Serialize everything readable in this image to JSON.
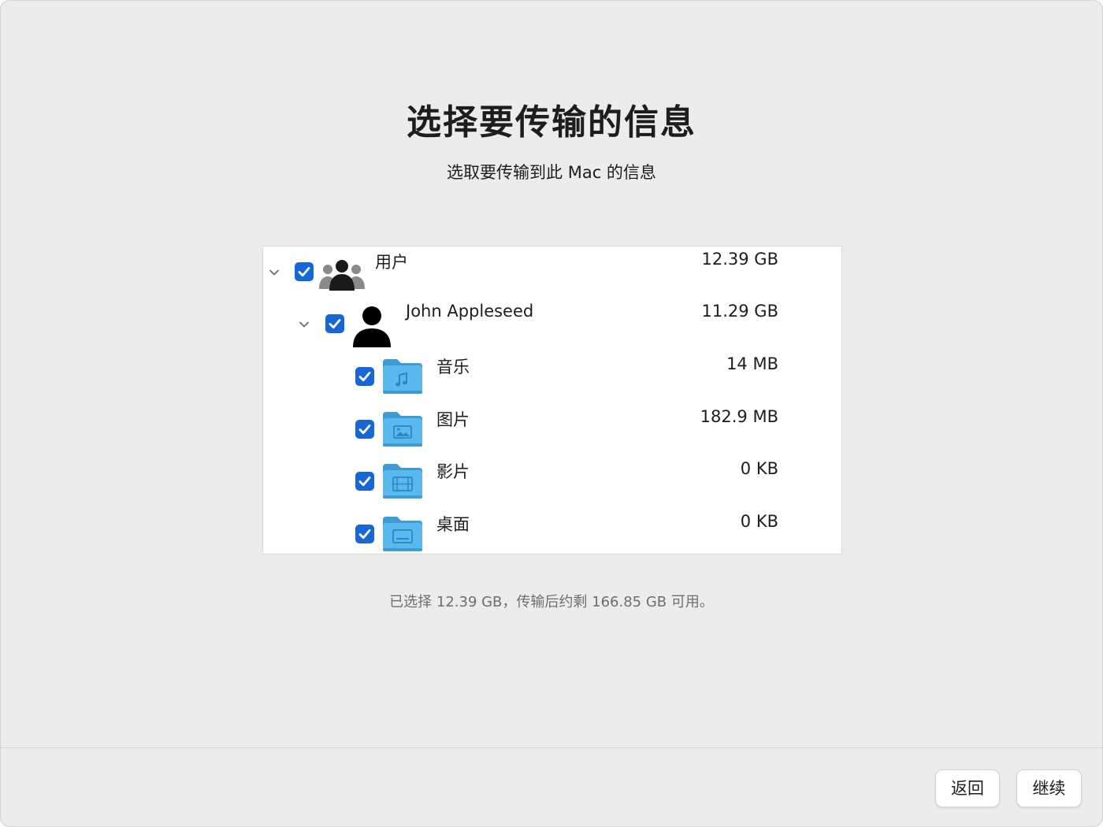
{
  "header": {
    "title": "选择要传输的信息",
    "subtitle": "选取要传输到此 Mac 的信息"
  },
  "tree": {
    "users_group": {
      "label": "用户",
      "size": "12.39 GB",
      "checked": true,
      "expanded": true
    },
    "user": {
      "label": "John Appleseed",
      "size": "11.29 GB",
      "checked": true,
      "expanded": true
    },
    "folders": [
      {
        "label": "音乐",
        "size": "14 MB",
        "checked": true,
        "icon": "music-folder-icon"
      },
      {
        "label": "图片",
        "size": "182.9 MB",
        "checked": true,
        "icon": "pictures-folder-icon"
      },
      {
        "label": "影片",
        "size": "0 KB",
        "checked": true,
        "icon": "movies-folder-icon"
      },
      {
        "label": "桌面",
        "size": "0 KB",
        "checked": true,
        "icon": "desktop-folder-icon"
      }
    ]
  },
  "summary": "已选择 12.39 GB，传输后约剩 166.85 GB 可用。",
  "footer": {
    "back_label": "返回",
    "continue_label": "继续"
  },
  "colors": {
    "checkbox": "#1766d6",
    "folder": "#5ab8ec",
    "background": "#ececec"
  }
}
